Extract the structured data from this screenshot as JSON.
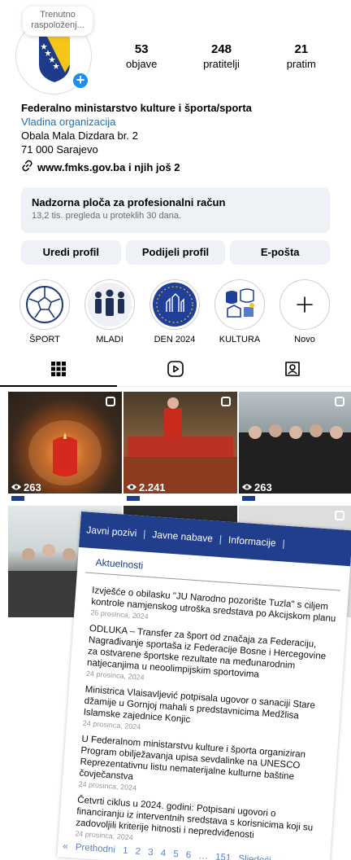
{
  "profile": {
    "note": "Trenutno raspoloženj...",
    "stats": [
      {
        "value": "53",
        "label": "objave"
      },
      {
        "value": "248",
        "label": "pratitelji"
      },
      {
        "value": "21",
        "label": "pratim"
      }
    ],
    "name": "Federalno ministarstvo kulture i športa/sporta",
    "category": "Vladina organizacija",
    "address_line1": "Obala Mala Dizdara br. 2",
    "address_line2": "71 000 Sarajevo",
    "link": "www.fmks.gov.ba i njih još 2"
  },
  "dashboard": {
    "title": "Nadzorna ploča za profesionalni račun",
    "subtitle": "13,2 tis. pregleda u proteklih 30 dana."
  },
  "buttons": {
    "edit": "Uredi profil",
    "share": "Podijeli profil",
    "email": "E-pošta"
  },
  "highlights": [
    {
      "label": "ŠPORT"
    },
    {
      "label": "MLADI"
    },
    {
      "label": "DEN 2024"
    },
    {
      "label": "KULTURA"
    },
    {
      "label": "Novo"
    }
  ],
  "posts": {
    "views": [
      "263",
      "2.241",
      "263"
    ]
  },
  "overlay": {
    "nav": [
      "Javni pozivi",
      "Javne nabave",
      "Informacije"
    ],
    "section": "Aktuelnosti",
    "items": [
      {
        "title": "Izvješće o obilasku \"JU Narodno pozorište Tuzla\" s ciljem kontrole namjenskog utroška sredstava po Akcijskom planu",
        "date": "26 prosinca, 2024"
      },
      {
        "title": "ODLUKA – Transfer za šport od značaja za Federaciju, Nagrađivanje sportaša iz Federacije Bosne i Hercegovine za ostvarene športske rezultate na međunarodnim natjecanjima u neoolimpijskim sportovima",
        "date": "24 prosinca, 2024"
      },
      {
        "title": "Ministrica Vlaisavljević potpisala ugovor o sanaciji Stare džamije u Gornjoj mahali s predstavnicima Medžlisa Islamske zajednice Konjic",
        "date": "24 prosinca, 2024"
      },
      {
        "title": "U Federalnom ministarstvu kulture i športa organiziran Program obilježavanja upisa sevdalinke na UNESCO Reprezentativnu listu nematerijalne kulturne baštine čovječanstva",
        "date": "24 prosinca, 2024"
      },
      {
        "title": "Četvrti ciklus u 2024. godini: Potpisani ugovori o financiranju iz interventnih sredstava s korisnicima koji su zadovoljili kriterije hitnosti i nepredviđenosti",
        "date": "24 prosinca, 2024"
      }
    ],
    "pagination": "« Prethodni 1 2 3 4 5 6 … 151 Sljedeći »"
  }
}
